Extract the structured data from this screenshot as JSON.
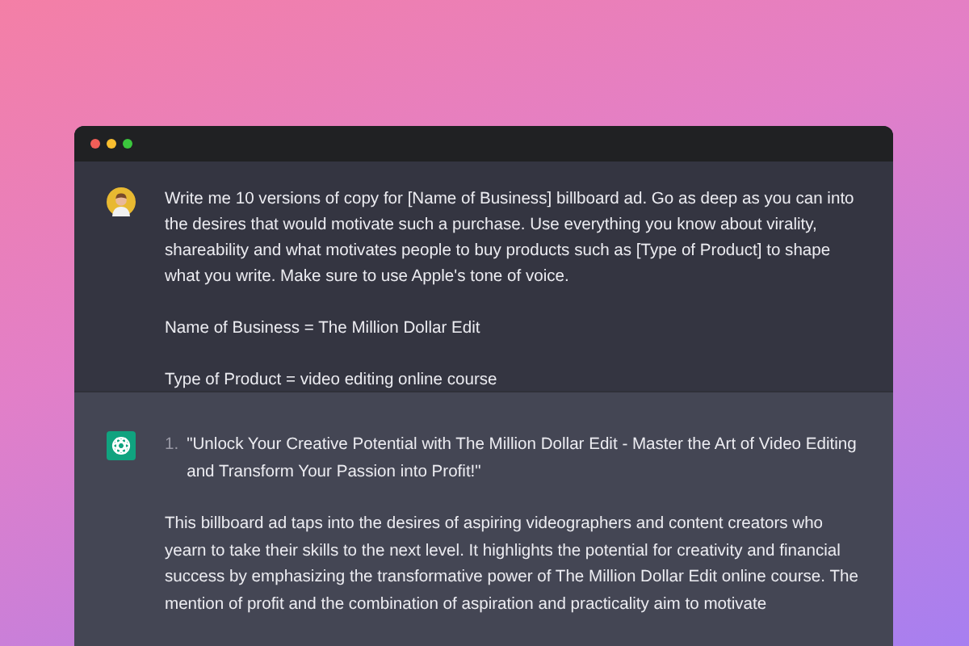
{
  "user_message": {
    "paragraphs": [
      "Write me 10 versions of copy for [Name of Business] billboard ad. Go as deep as you can into the desires that would motivate such a purchase. Use everything you know about virality, shareability and what motivates people to buy products such as [Type of Product] to shape what you write. Make sure to use Apple's tone of voice.",
      "Name of Business = The Million Dollar Edit",
      "Type of Product = video editing online course"
    ]
  },
  "assistant_message": {
    "list": [
      {
        "number": "1.",
        "text": "\"Unlock Your Creative Potential with The Million Dollar Edit - Master the Art of Video Editing and Transform Your Passion into Profit!\""
      }
    ],
    "paragraphs": [
      "This billboard ad taps into the desires of aspiring videographers and content creators who yearn to take their skills to the next level. It highlights the potential for creativity and financial success by emphasizing the transformative power of The Million Dollar Edit online course. The mention of profit and the combination of aspiration and practicality aim to motivate"
    ]
  }
}
